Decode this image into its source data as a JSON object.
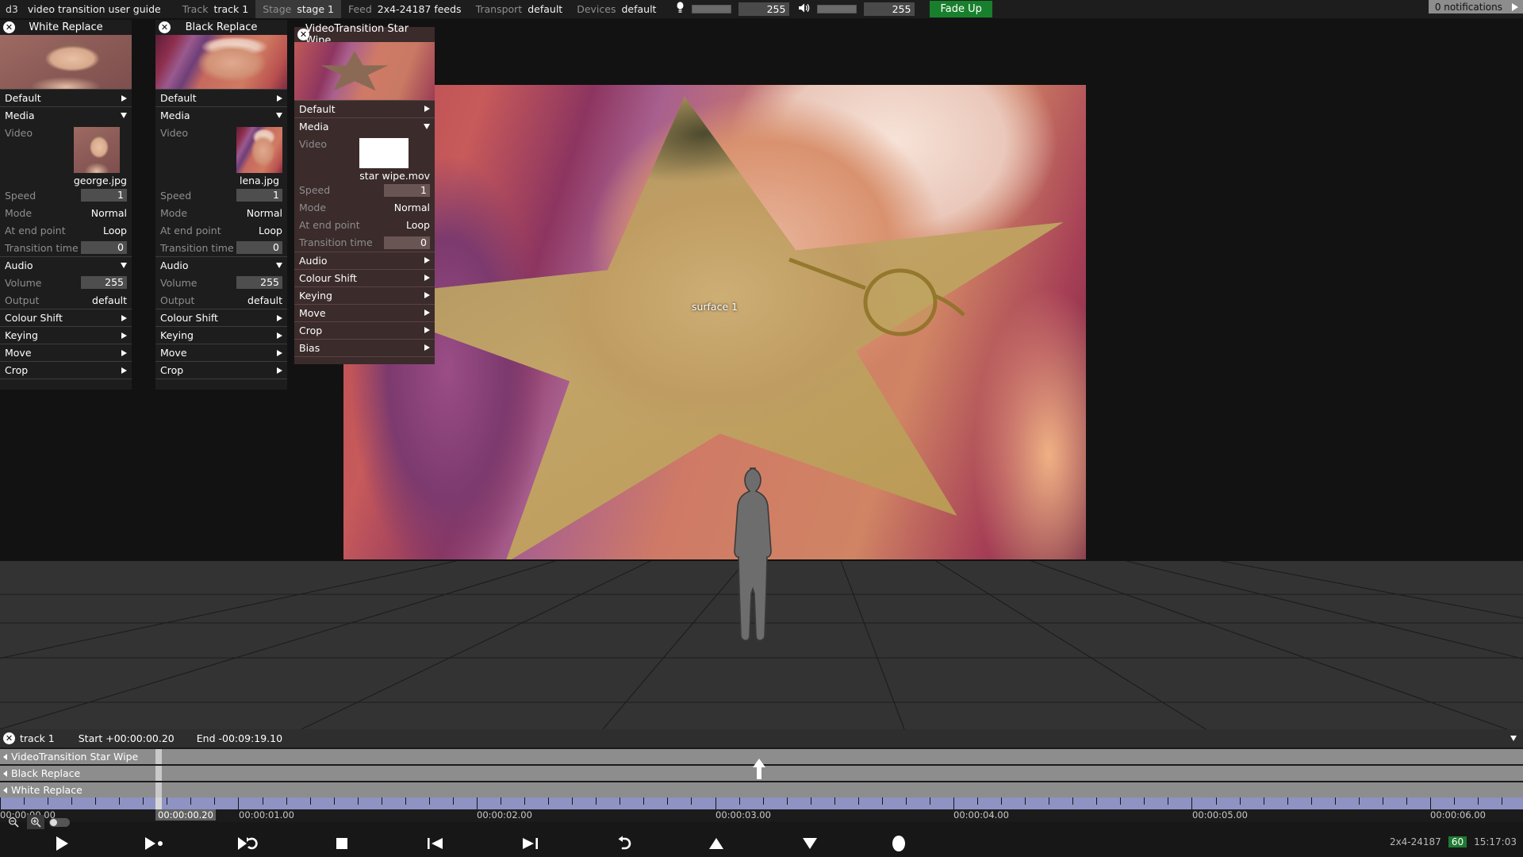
{
  "topbar": {
    "session": "d3",
    "title": "video transition user guide",
    "track_label": "Track",
    "track_value": "track 1",
    "stage_label": "Stage",
    "stage_value": "stage 1",
    "feed_label": "Feed",
    "feed_value": "2x4-24187 feeds",
    "transport_label": "Transport",
    "transport_value": "default",
    "devices_label": "Devices",
    "devices_value": "default",
    "brightness_value": "255",
    "volume_value": "255",
    "fade_button": "Fade Up",
    "notifications": "0 notifications",
    "accent_green": "#18802c"
  },
  "panels": [
    {
      "title": "White Replace",
      "default_label": "Default",
      "media_label": "Media",
      "video_label": "Video",
      "media_name": "george.jpg",
      "speed_label": "Speed",
      "speed_value": "1",
      "mode_label": "Mode",
      "mode_value": "Normal",
      "endpoint_label": "At end point",
      "endpoint_value": "Loop",
      "transition_label": "Transition time",
      "transition_value": "0",
      "audio_label": "Audio",
      "volume_label": "Volume",
      "volume_value": "255",
      "output_label": "Output",
      "output_value": "default",
      "colour_shift_label": "Colour Shift",
      "keying_label": "Keying",
      "move_label": "Move",
      "crop_label": "Crop"
    },
    {
      "title": "Black Replace",
      "default_label": "Default",
      "media_label": "Media",
      "video_label": "Video",
      "media_name": "lena.jpg",
      "speed_label": "Speed",
      "speed_value": "1",
      "mode_label": "Mode",
      "mode_value": "Normal",
      "endpoint_label": "At end point",
      "endpoint_value": "Loop",
      "transition_label": "Transition time",
      "transition_value": "0",
      "audio_label": "Audio",
      "volume_label": "Volume",
      "volume_value": "255",
      "output_label": "Output",
      "output_value": "default",
      "colour_shift_label": "Colour Shift",
      "keying_label": "Keying",
      "move_label": "Move",
      "crop_label": "Crop"
    },
    {
      "title": "VideoTransition Star Wipe",
      "default_label": "Default",
      "media_label": "Media",
      "video_label": "Video",
      "media_name": "star wipe.mov",
      "speed_label": "Speed",
      "speed_value": "1",
      "mode_label": "Mode",
      "mode_value": "Normal",
      "endpoint_label": "At end point",
      "endpoint_value": "Loop",
      "transition_label": "Transition time",
      "transition_value": "0",
      "audio_label": "Audio",
      "colour_shift_label": "Colour Shift",
      "keying_label": "Keying",
      "move_label": "Move",
      "crop_label": "Crop",
      "bias_label": "Bias"
    }
  ],
  "stage": {
    "surface_label": "surface 1"
  },
  "timeline": {
    "track_name": "track 1",
    "start_label": "Start +00:00:00.20",
    "end_label": "End -00:09:19.10",
    "rows": [
      "VideoTransition Star Wipe",
      "Black Replace",
      "White Replace"
    ],
    "current_time": "00:00:00.20",
    "ruler_labels": [
      "00:00:00.00",
      "00:00:01.00",
      "00:00:02.00",
      "00:00:03.00",
      "00:00:04.00",
      "00:00:05.00",
      "00:00:06.00"
    ]
  },
  "bottombar": {
    "feed_id": "2x4-24187",
    "fps": "60",
    "clock": "15:17:03"
  }
}
